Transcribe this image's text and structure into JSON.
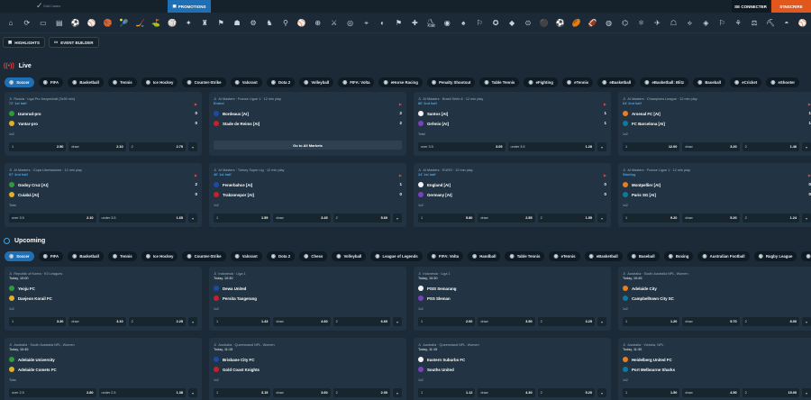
{
  "header": {
    "logo_text": "Gold Casino",
    "promotions": "PROMOTIONS",
    "login": "SE CONNECTER",
    "register": "S'INSCRIRE"
  },
  "subtabs": {
    "highlights": "HIGHLIGHTS",
    "event_builder": "EVENT BUILDER"
  },
  "live": {
    "title": "Live",
    "chips": [
      "Soccer",
      "FIFA",
      "Basketball",
      "Tennis",
      "Ice Hockey",
      "Counter-Strike",
      "Valorant",
      "Dota 2",
      "Volleyball",
      "FIFA: Volta",
      "eHorse Racing",
      "Penalty Shootout",
      "Table Tennis",
      "eFighting",
      "eTennis",
      "eBasketball",
      "eBasketball: Blitz",
      "Baseball",
      "eCricket",
      "eShooter"
    ],
    "cards": [
      {
        "league": "Russia · Liga Pro Kecpechall (3x30 min)",
        "status": "72' 1st half",
        "t1": "Izumrud-pro",
        "t2": "Yantar-pro",
        "s1": "0",
        "s2": "0",
        "market": "1x2",
        "o": [
          [
            "1",
            "2.50"
          ],
          [
            "draw",
            "2.10"
          ],
          [
            "2",
            "2.75"
          ]
        ]
      },
      {
        "league": "AI Masters · France Ligue 1 · 12 min play",
        "status": "Ended",
        "t1": "Bordeaux [AI]",
        "t2": "Stade de Reims [AI]",
        "s1": "2",
        "s2": "2",
        "market": "",
        "goto": "Go to All Markets"
      },
      {
        "league": "AI Masters · Brasil Série A · 12 min play",
        "status": "86' 2nd half",
        "t1": "Santos [AI]",
        "t2": "Grêmio [AI]",
        "s1": "1",
        "s2": "1",
        "market": "Total",
        "o": [
          [
            "over 3.5",
            "3.05"
          ],
          [
            "under 3.5",
            "1.28"
          ]
        ]
      },
      {
        "league": "AI Masters · Champions League · 12 min play",
        "status": "64' 2nd half",
        "t1": "Arsenal FC [AI]",
        "t2": "FC Barcelona [AI]",
        "s1": "1",
        "s2": "1",
        "market": "1x2",
        "o": [
          [
            "1",
            "12.00"
          ],
          [
            "draw",
            "3.20"
          ],
          [
            "2",
            "1.46"
          ]
        ]
      },
      {
        "league": "AI Masters · Copa Libertadores · 12 min play",
        "status": "57' 2nd half",
        "t1": "Godoy Cruz [AI]",
        "t2": "Cuiabá [AI]",
        "s1": "2",
        "s2": "0",
        "market": "Total",
        "o": [
          [
            "over 3.5",
            "2.10"
          ],
          [
            "under 3.5",
            "1.65"
          ]
        ]
      },
      {
        "league": "AI Masters · Turkey Super Lig · 12 min play",
        "status": "40' 1st half",
        "t1": "Fenerbahce [AI]",
        "t2": "Trabzonspor [AI]",
        "s1": "1",
        "s2": "0",
        "market": "1x2",
        "o": [
          [
            "1",
            "1.55"
          ],
          [
            "draw",
            "3.45"
          ],
          [
            "2",
            "5.60"
          ]
        ]
      },
      {
        "league": "AI Masters · EURO · 12 min play",
        "status": "24' 1st half",
        "t1": "England [AI]",
        "t2": "Germany [AI]",
        "s1": "0",
        "s2": "0",
        "market": "1x2",
        "o": [
          [
            "1",
            "5.80"
          ],
          [
            "draw",
            "2.55"
          ],
          [
            "2",
            "1.55"
          ]
        ]
      },
      {
        "league": "AI Masters · France Ligue 1 · 12 min play",
        "status": "Starting",
        "t1": "Montpellier [AI]",
        "t2": "Paris SG [AI]",
        "s1": "0",
        "s2": "0",
        "market": "1x2",
        "o": [
          [
            "1",
            "9.20"
          ],
          [
            "draw",
            "5.20"
          ],
          [
            "2",
            "1.24"
          ]
        ]
      }
    ]
  },
  "upcoming": {
    "title": "Upcoming",
    "chips": [
      "Soccer",
      "FIFA",
      "Basketball",
      "Tennis",
      "Ice Hockey",
      "Counter-Strike",
      "Valorant",
      "Dota 2",
      "Chess",
      "Volleyball",
      "League of Legends",
      "FIFA: Volta",
      "Handball",
      "Table Tennis",
      "eTennis",
      "eBasketball",
      "Baseball",
      "Boxing",
      "Australian Football",
      "Rugby League",
      "eCricket"
    ],
    "cards": [
      {
        "league": "Republic of Korea · K3 Leagues",
        "status": "Today, 10:00",
        "t1": "Yeoju FC",
        "t2": "Daejeon Korail FC",
        "market": "1x2",
        "o": [
          [
            "1",
            "3.30"
          ],
          [
            "draw",
            "3.10"
          ],
          [
            "2",
            "2.25"
          ]
        ]
      },
      {
        "league": "Indonesia · Liga 1",
        "status": "Today, 10:30",
        "t1": "Dewa United",
        "t2": "Persita Tangerang",
        "market": "1x2",
        "o": [
          [
            "1",
            "1.43"
          ],
          [
            "draw",
            "4.60"
          ],
          [
            "2",
            "6.60"
          ]
        ]
      },
      {
        "league": "Indonesia · Liga 1",
        "status": "Today, 10:30",
        "t1": "PSIS Semarang",
        "t2": "PSS Sleman",
        "market": "1x2",
        "o": [
          [
            "1",
            "2.00"
          ],
          [
            "draw",
            "3.50"
          ],
          [
            "2",
            "3.25"
          ]
        ]
      },
      {
        "league": "Australia · South Australia NPL, Women",
        "status": "Today, 10:45",
        "t1": "Adelaide City",
        "t2": "Campbelltown City SC",
        "market": "1x2",
        "o": [
          [
            "1",
            "1.20"
          ],
          [
            "draw",
            "5.70"
          ],
          [
            "2",
            "8.00"
          ]
        ]
      },
      {
        "league": "Australia · South Australia NPL, Women",
        "status": "Today, 10:45",
        "t1": "Adelaide University",
        "t2": "Adelaide Comets FC",
        "market": "Total",
        "o": [
          [
            "over 2.5",
            "2.80"
          ],
          [
            "under 2.5",
            "1.38"
          ]
        ]
      },
      {
        "league": "Australia · Queensland NPL, Women",
        "status": "Today, 11:15",
        "t1": "Brisbane City FC",
        "t2": "Gold Coast Knights",
        "market": "1x2",
        "o": [
          [
            "1",
            "3.15"
          ],
          [
            "draw",
            "3.60"
          ],
          [
            "2",
            "2.00"
          ]
        ]
      },
      {
        "league": "Australia · Queensland NPL, Women",
        "status": "Today, 11:15",
        "t1": "Eastern Suburbs FC",
        "t2": "Souths United",
        "market": "1x2",
        "o": [
          [
            "1",
            "1.12"
          ],
          [
            "draw",
            "4.30"
          ],
          [
            "2",
            "5.20"
          ]
        ]
      },
      {
        "league": "Australia · Victoria, NPL",
        "status": "Today, 11:30",
        "t1": "Heidelberg United FC",
        "t2": "Port Melbourne Sharks",
        "market": "1x2",
        "o": [
          [
            "1",
            "1.50"
          ],
          [
            "draw",
            "4.50"
          ],
          [
            "2",
            "15.00"
          ]
        ]
      }
    ]
  }
}
